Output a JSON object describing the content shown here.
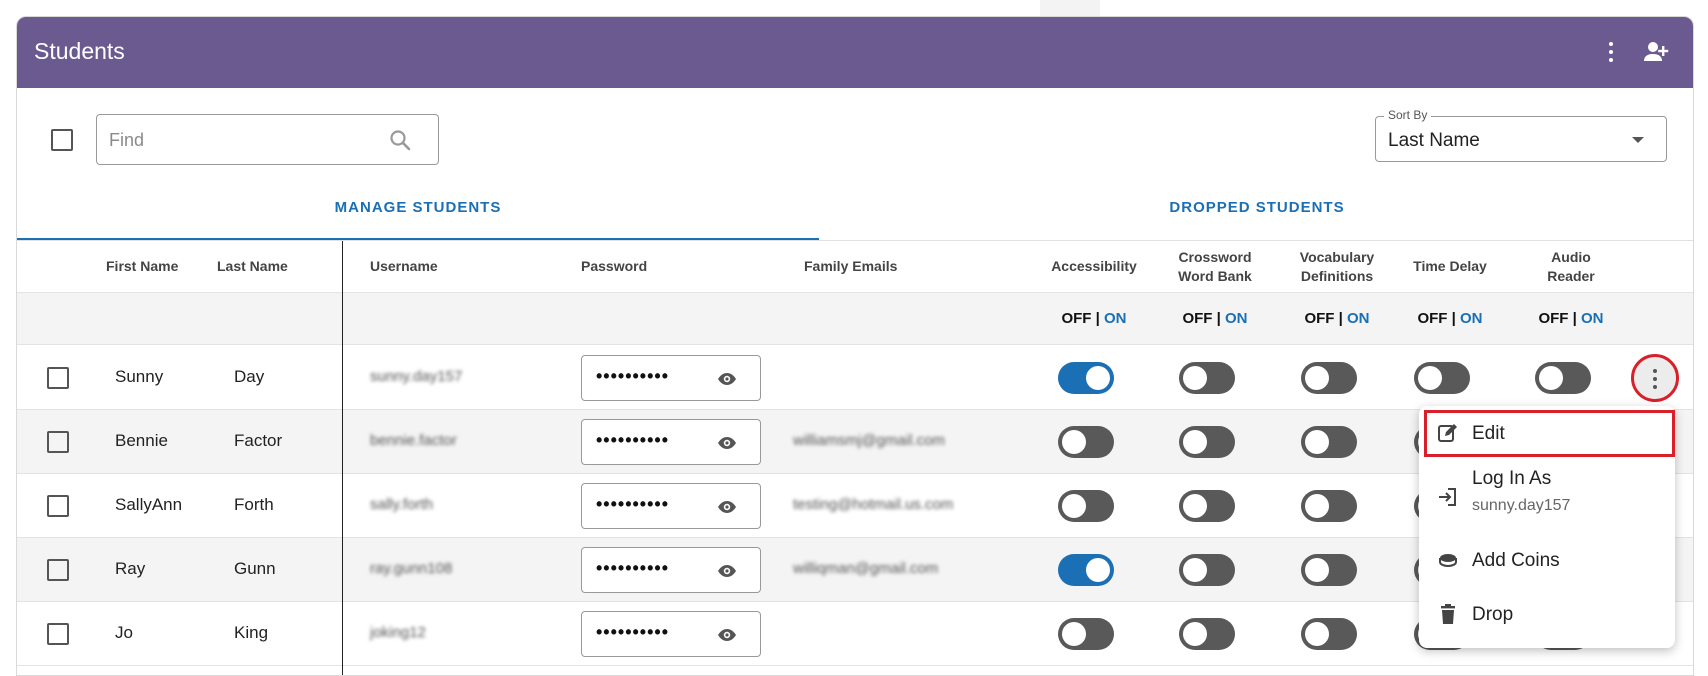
{
  "header": {
    "title": "Students"
  },
  "search": {
    "placeholder": "Find"
  },
  "sort": {
    "legend": "Sort By",
    "value": "Last Name"
  },
  "tabs": [
    {
      "label": "MANAGE STUDENTS",
      "active": true
    },
    {
      "label": "DROPPED STUDENTS",
      "active": false
    }
  ],
  "columns": {
    "first_name": "First Name",
    "last_name": "Last Name",
    "username": "Username",
    "password": "Password",
    "family_emails": "Family Emails",
    "accessibility": "Accessibility",
    "crossword_line1": "Crossword",
    "crossword_line2": "Word Bank",
    "vocabulary_line1": "Vocabulary",
    "vocabulary_line2": "Definitions",
    "time_delay": "Time Delay",
    "audio_line1": "Audio",
    "audio_line2": "Reader"
  },
  "onoff": {
    "off": "OFF",
    "sep": " | ",
    "on": "ON"
  },
  "rows": [
    {
      "first": "Sunny",
      "last": "Day",
      "username": "sunny.day157",
      "password": "••••••••••",
      "email": "",
      "toggles": [
        true,
        false,
        false,
        false,
        false
      ]
    },
    {
      "first": "Bennie",
      "last": "Factor",
      "username": "bennie.factor",
      "password": "••••••••••",
      "email": "williamsmj@gmail.com",
      "toggles": [
        false,
        false,
        false,
        false,
        false
      ]
    },
    {
      "first": "SallyAnn",
      "last": "Forth",
      "username": "sally.forth",
      "password": "••••••••••",
      "email": "testing@hotmail.us.com",
      "toggles": [
        false,
        false,
        false,
        false,
        false
      ]
    },
    {
      "first": "Ray",
      "last": "Gunn",
      "username": "ray.gunn108",
      "password": "••••••••••",
      "email": "williqman@gmail.com",
      "toggles": [
        true,
        false,
        false,
        false,
        false
      ]
    },
    {
      "first": "Jo",
      "last": "King",
      "username": "joking12",
      "password": "••••••••••",
      "email": "",
      "toggles": [
        false,
        false,
        false,
        false,
        false
      ]
    }
  ],
  "menu": {
    "edit": "Edit",
    "login_as": "Log In As",
    "login_user": "sunny.day157",
    "add_coins": "Add Coins",
    "drop": "Drop"
  },
  "colors": {
    "header": "#6b5a90",
    "accent": "#1a6fb5",
    "highlight": "#d9202a"
  }
}
